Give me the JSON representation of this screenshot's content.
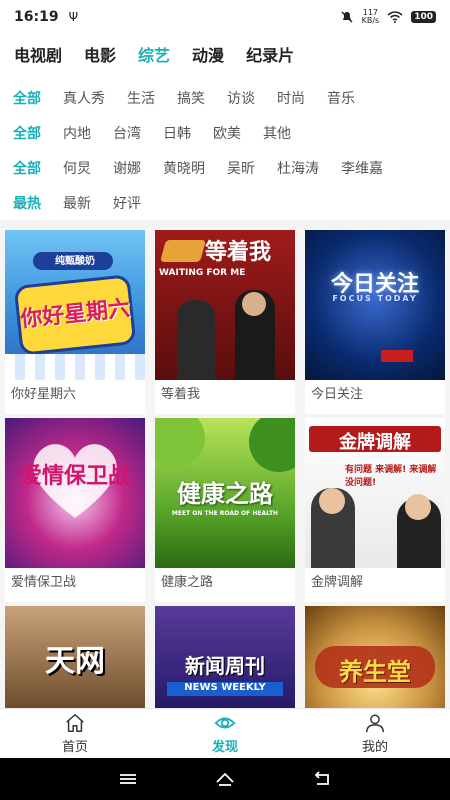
{
  "status_bar": {
    "time": "16:19",
    "usb_glyph": "Ψ",
    "net_speed_value": "117",
    "net_speed_unit": "KB/s",
    "battery": "100"
  },
  "category_tabs": [
    {
      "label": "电视剧",
      "active": false
    },
    {
      "label": "电影",
      "active": false
    },
    {
      "label": "综艺",
      "active": true
    },
    {
      "label": "动漫",
      "active": false
    },
    {
      "label": "纪录片",
      "active": false
    }
  ],
  "filters": {
    "genre": [
      "全部",
      "真人秀",
      "生活",
      "搞笑",
      "访谈",
      "时尚",
      "音乐"
    ],
    "region": [
      "全部",
      "内地",
      "台湾",
      "日韩",
      "欧美",
      "其他"
    ],
    "host": [
      "全部",
      "何炅",
      "谢娜",
      "黄晓明",
      "吴昕",
      "杜海涛",
      "李维嘉"
    ],
    "sort": [
      "最热",
      "最新",
      "好评"
    ]
  },
  "shows": [
    {
      "name": "你好星期六",
      "poster_text": "你好星期六",
      "poster_small": "纯甄酸奶",
      "bg": "#3a8fd9"
    },
    {
      "name": "等着我",
      "poster_text": "等着我",
      "poster_small": "WAITING FOR ME",
      "bg": "#7a1414"
    },
    {
      "name": "今日关注",
      "poster_text": "今日关注",
      "poster_small": "FOCUS TODAY",
      "bg": "#0a2a6e"
    },
    {
      "name": "爱情保卫战",
      "poster_text": "爱情保卫战",
      "poster_small": "",
      "bg": "#c0298a"
    },
    {
      "name": "健康之路",
      "poster_text": "健康之路",
      "poster_small": "MEET ON THE ROAD OF HEALTH",
      "bg": "#5aa82a"
    },
    {
      "name": "金牌调解",
      "poster_text": "金牌调解",
      "poster_small": "有问题 来调解! 来调解 没问题!",
      "bg": "#f2f2f2"
    },
    {
      "name": "",
      "poster_text": "天网",
      "poster_small": "",
      "bg": "#6b4a2a"
    },
    {
      "name": "",
      "poster_text": "新闻周刊",
      "poster_small": "NEWS WEEKLY",
      "bg": "#2a1e6e"
    },
    {
      "name": "",
      "poster_text": "养生堂",
      "poster_small": "",
      "bg": "#c79040"
    }
  ],
  "bottom_nav": [
    {
      "label": "首页",
      "icon": "home-icon",
      "active": false
    },
    {
      "label": "发现",
      "icon": "eye-icon",
      "active": true
    },
    {
      "label": "我的",
      "icon": "person-icon",
      "active": false
    }
  ],
  "colors": {
    "accent": "#1ab0b8"
  }
}
